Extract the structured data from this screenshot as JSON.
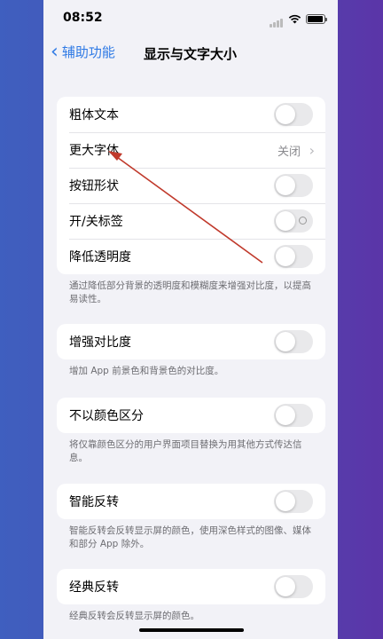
{
  "status": {
    "time": "08:52"
  },
  "nav": {
    "back_label": "辅助功能",
    "title": "显示与文字大小"
  },
  "group1": {
    "rows": [
      {
        "label": "粗体文本",
        "on": false
      },
      {
        "label": "更大字体",
        "value": "关闭"
      },
      {
        "label": "按钮形状",
        "on": false
      },
      {
        "label": "开/关标签",
        "on": false
      },
      {
        "label": "降低透明度",
        "on": false
      }
    ],
    "note": "通过降低部分背景的透明度和模糊度来增强对比度，以提高易读性。"
  },
  "group2": {
    "label": "增强对比度",
    "on": false,
    "note": "增加 App 前景色和背景色的对比度。"
  },
  "group3": {
    "label": "不以颜色区分",
    "on": false,
    "note": "将仅靠颜色区分的用户界面项目替换为用其他方式传达信息。"
  },
  "group4": {
    "label": "智能反转",
    "on": false,
    "note": "智能反转会反转显示屏的颜色，使用深色样式的图像、媒体和部分 App 除外。"
  },
  "group5": {
    "label": "经典反转",
    "on": false,
    "note": "经典反转会反转显示屏的颜色。"
  },
  "colors": {
    "accent": "#2f7ae5",
    "annotation_arrow": "#c0392b"
  }
}
